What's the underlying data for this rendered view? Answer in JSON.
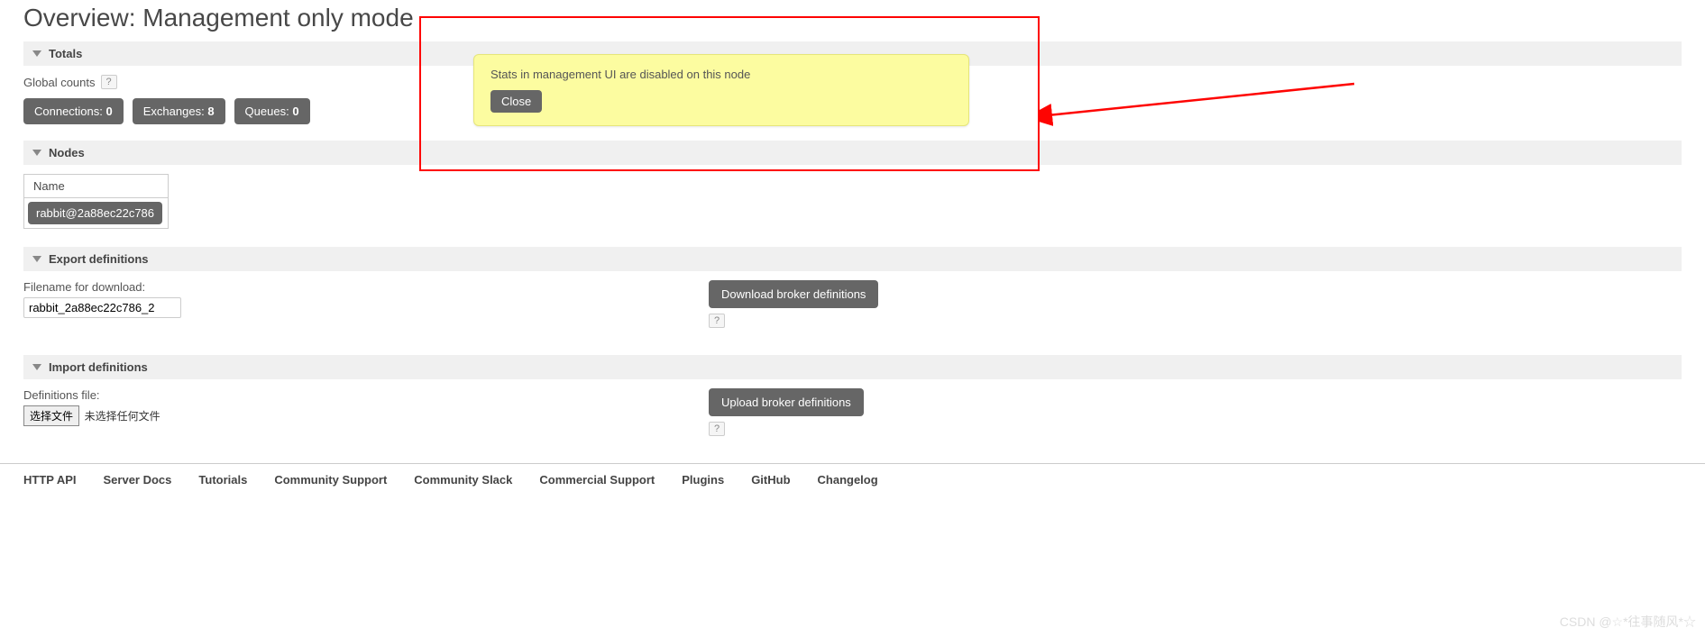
{
  "page_title": "Overview: Management only mode",
  "sections": {
    "totals": "Totals",
    "nodes": "Nodes",
    "export": "Export definitions",
    "import": "Import definitions"
  },
  "global_counts": {
    "label": "Global counts",
    "help": "?",
    "items": [
      {
        "label": "Connections:",
        "value": "0"
      },
      {
        "label": "Exchanges:",
        "value": "8"
      },
      {
        "label": "Queues:",
        "value": "0"
      }
    ]
  },
  "nodes": {
    "header": "Name",
    "rows": [
      "rabbit@2a88ec22c786"
    ]
  },
  "export": {
    "filename_label": "Filename for download:",
    "filename_value": "rabbit_2a88ec22c786_2",
    "button": "Download broker definitions",
    "help": "?"
  },
  "import": {
    "file_label": "Definitions file:",
    "choose_button": "选择文件",
    "no_file": "未选择任何文件",
    "button": "Upload broker definitions",
    "help": "?"
  },
  "alert": {
    "message": "Stats in management UI are disabled on this node",
    "close": "Close"
  },
  "footer": [
    "HTTP API",
    "Server Docs",
    "Tutorials",
    "Community Support",
    "Community Slack",
    "Commercial Support",
    "Plugins",
    "GitHub",
    "Changelog"
  ],
  "watermark": "CSDN @☆*往事随风*☆"
}
